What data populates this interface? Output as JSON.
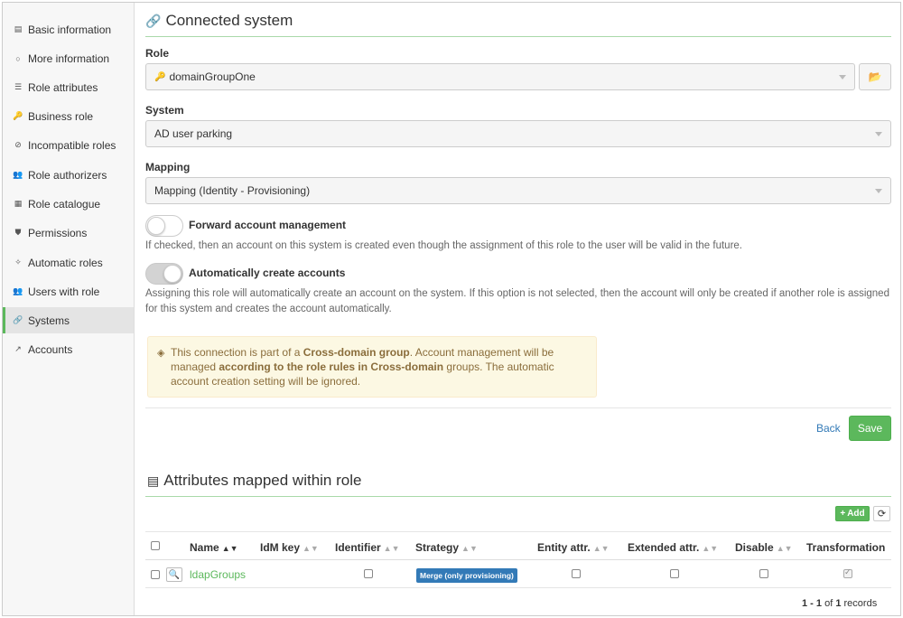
{
  "sidebar": {
    "items": [
      {
        "icon": "card-icon",
        "glyph": "▤",
        "label": "Basic information"
      },
      {
        "icon": "circle-icon",
        "glyph": "○",
        "label": "More information"
      },
      {
        "icon": "list-icon",
        "glyph": "☰",
        "label": "Role attributes"
      },
      {
        "icon": "key-icon",
        "glyph": "🔑",
        "label": "Business role"
      },
      {
        "icon": "ban-icon",
        "glyph": "⊘",
        "label": "Incompatible roles"
      },
      {
        "icon": "users-icon",
        "glyph": "👥",
        "label": "Role authorizers"
      },
      {
        "icon": "catalogue-icon",
        "glyph": "▦",
        "label": "Role catalogue"
      },
      {
        "icon": "shield-icon",
        "glyph": "⛊",
        "label": "Permissions"
      },
      {
        "icon": "magic-icon",
        "glyph": "✧",
        "label": "Automatic roles"
      },
      {
        "icon": "users-icon",
        "glyph": "👥",
        "label": "Users with role"
      },
      {
        "icon": "link-icon",
        "glyph": "🔗",
        "label": "Systems"
      },
      {
        "icon": "external-link-icon",
        "glyph": "↗",
        "label": "Accounts"
      }
    ],
    "active_index": 10
  },
  "connected_system": {
    "title": "Connected system",
    "role_label": "Role",
    "role_value": "domainGroupOne",
    "system_label": "System",
    "system_value": "AD user parking",
    "mapping_label": "Mapping",
    "mapping_value": "Mapping (Identity - Provisioning)",
    "forward_label": "Forward account management",
    "forward_on": false,
    "forward_help": "If checked, then an account on this system is created even though the assignment of this role to the user will be valid in the future.",
    "auto_label": "Automatically create accounts",
    "auto_on": true,
    "auto_help": "Assigning this role will automatically create an account on the system. If this option is not selected, then the account will only be created if another role is assigned for this system and creates the account automatically.",
    "alert_part1": "This connection is part of a ",
    "alert_bold1": "Cross-domain group",
    "alert_part2": ". Account management will be managed ",
    "alert_bold2": "according to the role rules in Cross-domain",
    "alert_part3": " groups. The automatic account creation setting will be ignored.",
    "back_label": "Back",
    "save_label": "Save"
  },
  "attributes": {
    "title": "Attributes mapped within role",
    "add_label": "Add",
    "columns": [
      "Name",
      "IdM key",
      "Identifier",
      "Strategy",
      "Entity attr.",
      "Extended attr.",
      "Disable",
      "Transformation"
    ],
    "rows": [
      {
        "name": "ldapGroups",
        "idm_key": "",
        "identifier": false,
        "strategy": "Merge (only provisioning)",
        "entity_attr": false,
        "extended_attr": false,
        "disable": false,
        "transformation": true
      }
    ],
    "pager_range": "1 - 1",
    "pager_of": "of",
    "pager_total": "1",
    "pager_suffix": "records"
  },
  "colors": {
    "accent_green": "#5cb85c",
    "link_blue": "#337ab7",
    "badge_blue": "#337ab7",
    "alert_bg": "#fcf8e3"
  }
}
